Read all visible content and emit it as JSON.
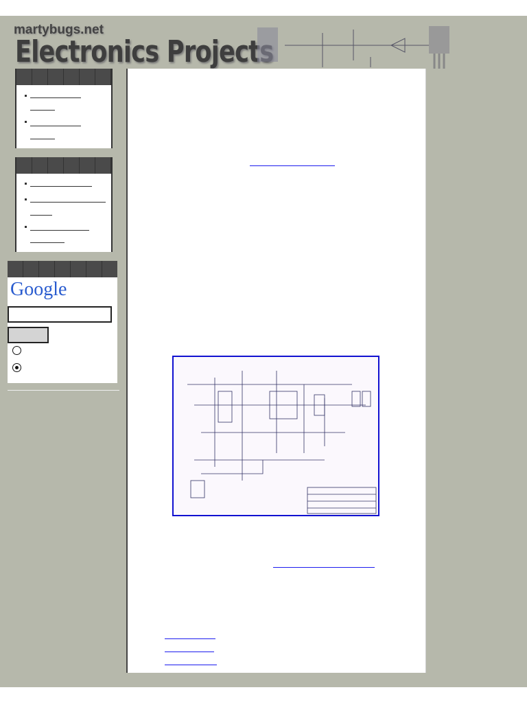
{
  "header": {
    "site_name": "martybugs.net",
    "title": "Electronics Projects"
  },
  "search": {
    "logo_text": "Google",
    "query": "",
    "search_button": "",
    "radio_selected": 2
  },
  "colors": {
    "background": "#b6b8ab",
    "link": "#1a1aee",
    "schematic_border": "#1010d0"
  }
}
